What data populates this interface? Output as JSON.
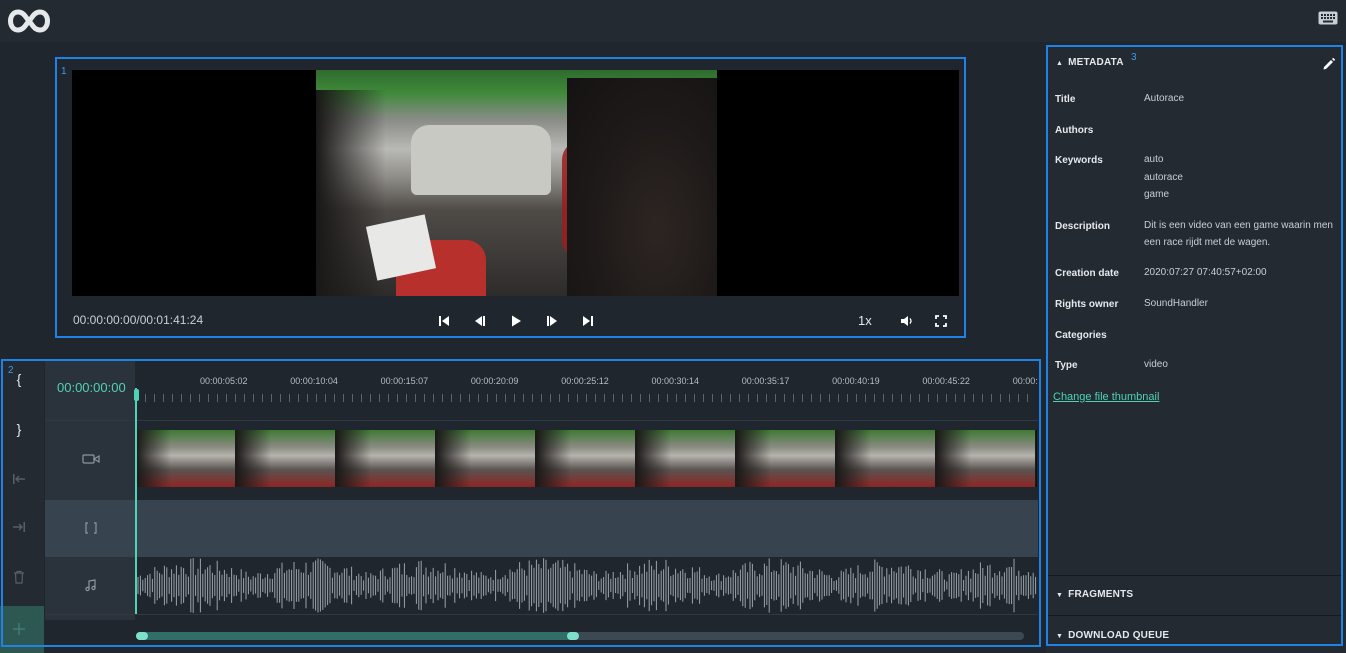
{
  "app": {
    "logo_icon": "infinity-logo-icon",
    "keyboard_icon": "keyboard-icon"
  },
  "regions": {
    "player": "1",
    "timeline": "2",
    "sidebar": "3"
  },
  "player": {
    "time_display": "00:00:00:00/00:01:41:24",
    "speed": "1x",
    "controls": [
      "skip-to-start-icon",
      "previous-frame-icon",
      "play-icon",
      "next-frame-icon",
      "skip-to-end-icon",
      "volume-icon",
      "fullscreen-icon"
    ]
  },
  "timeline": {
    "timecode": "00:00:00:00",
    "ruler_labels": [
      "00:00:05:02",
      "00:00:10:04",
      "00:00:15:07",
      "00:00:20:09",
      "00:00:25:12",
      "00:00:30:14",
      "00:00:35:17",
      "00:00:40:19",
      "00:00:45:22",
      "00:00:"
    ],
    "tools": {
      "set_in": "{",
      "set_out": "}"
    },
    "tracks": [
      "video-track",
      "segment-track",
      "audio-track"
    ],
    "accent": "#51d1b5"
  },
  "sidebar": {
    "metadata_header": "METADATA",
    "fields": {
      "title_label": "Title",
      "title_value": "Autorace",
      "authors_label": "Authors",
      "keywords_label": "Keywords",
      "keywords": [
        "auto",
        "autorace",
        "game"
      ],
      "description_label": "Description",
      "description_line1": "Dit is een video van een game waarin men",
      "description_line2": "een race rijdt met de wagen.",
      "creation_label": "Creation date",
      "creation_value": "2020:07:27 07:40:57+02:00",
      "rights_label": "Rights owner",
      "rights_value": "SoundHandler",
      "categories_label": "Categories",
      "type_label": "Type",
      "type_value": "video"
    },
    "change_thumbnail": "Change file thumbnail",
    "fragments_header": "FRAGMENTS",
    "download_header": "DOWNLOAD QUEUE"
  }
}
